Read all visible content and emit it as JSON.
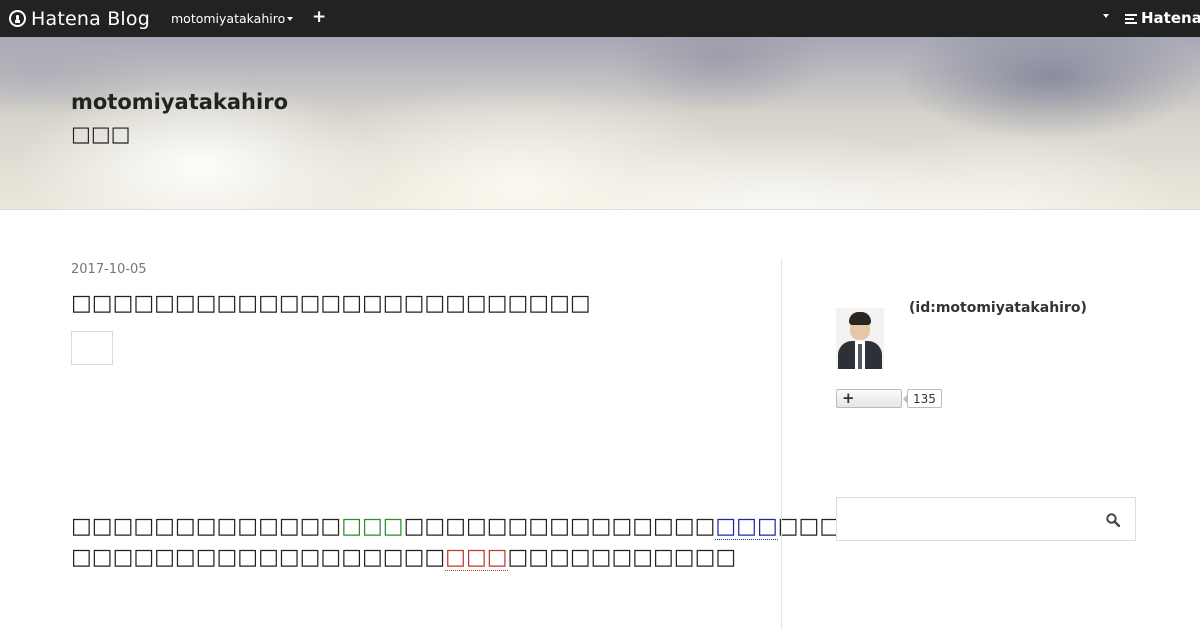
{
  "topbar": {
    "logo_text": "Hatena Blog",
    "user_menu_label": "motomiyatakahiro",
    "add_label": "+",
    "brand_right": "Hatena"
  },
  "header": {
    "blog_title": "motomiyatakahiro",
    "blog_description": "□□□"
  },
  "article": {
    "date": "2017-10-05",
    "title": "□□□□□□□□□□□□□□□□□□□□□□□□□",
    "body": {
      "seg1": "□□□□□□□□□□□□□",
      "seg2": "□□□",
      "seg3": "□□□□□□□□□□□□□□□",
      "seg4": "□□□",
      "seg5": "□□□□□□□□□□□□□□□□",
      "seg6": "□□□□□□□□□□□□□□□□□□",
      "seg7": "□□□",
      "seg8": "□□□□□□□□□□□"
    }
  },
  "sidebar": {
    "profile_id": "(id:motomiyatakahiro)",
    "follow_count": "135",
    "search_placeholder": ""
  },
  "colors": {
    "topbar_bg": "#222222",
    "highlight_green": "#2e8b2e",
    "highlight_blue": "#1a2a9c",
    "highlight_red": "#c0392b"
  }
}
